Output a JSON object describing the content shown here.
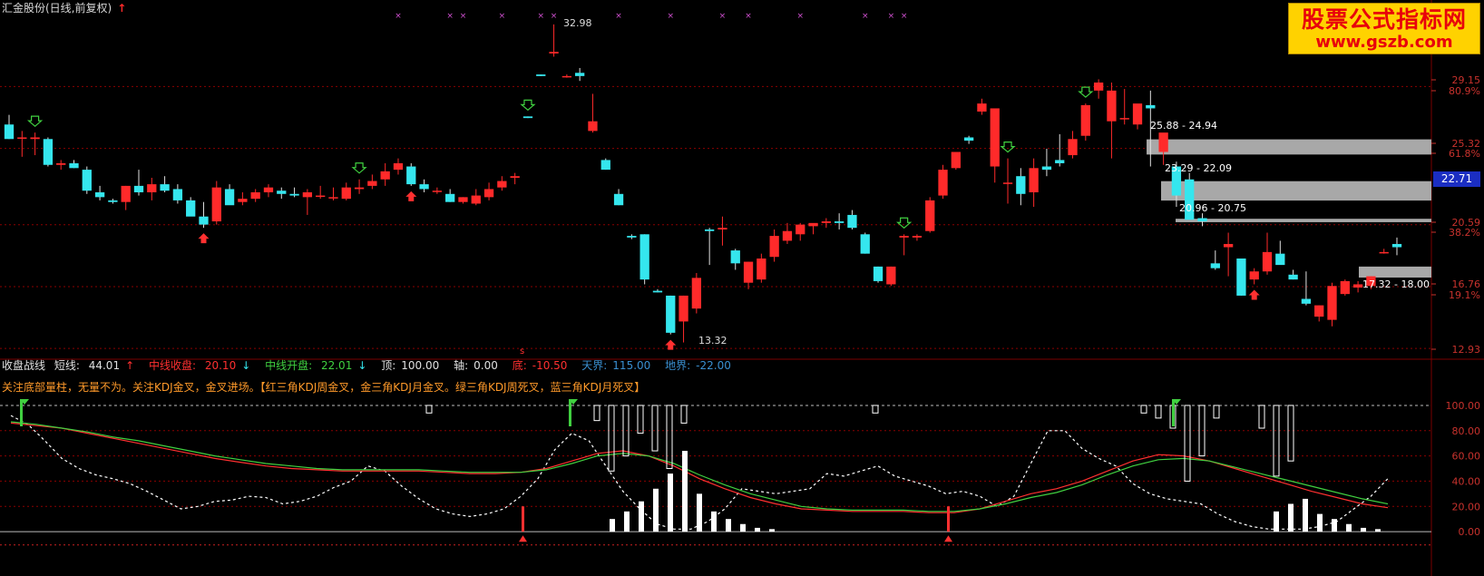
{
  "window": {
    "title": "汇金股份(日线,前复权)",
    "title_arrow": "↑"
  },
  "watermark": {
    "title": "股票公式指标网",
    "url": "www.gszb.com"
  },
  "colors": {
    "up": "#ff2a2a",
    "down": "#35e6ee",
    "bg": "#000000",
    "grid": "#8b0000",
    "zone": "#a8a8a8",
    "ma_red": "#ff3030",
    "ma_green": "#40d040",
    "magenta_marker": "#d050d0",
    "axis_text": "#c8322d"
  },
  "price_axis": {
    "ticks": [
      "29.15",
      "80.9%",
      "25.32",
      "61.8%",
      "20.59",
      "38.2%",
      "16.76",
      "19.1%",
      "12.93"
    ],
    "current_price": "22.71"
  },
  "price_annotations": {
    "high_label": "32.98",
    "low_label": "13.32",
    "zones": [
      "25.88 - 24.94",
      "23.29 - 22.09",
      "20.96 - 20.75",
      "17.32 - 18.00"
    ],
    "marker_s": "s"
  },
  "chart_data": {
    "type": "candlestick",
    "series_ohlc": [
      [
        26.8,
        27.4,
        25.9,
        25.9
      ],
      [
        26.0,
        26.4,
        24.8,
        26.0
      ],
      [
        25.9,
        26.3,
        24.9,
        26.0
      ],
      [
        25.9,
        26.0,
        24.2,
        24.3
      ],
      [
        24.3,
        24.6,
        24.0,
        24.4
      ],
      [
        24.4,
        24.6,
        24.1,
        24.1
      ],
      [
        24.0,
        24.2,
        22.5,
        22.7
      ],
      [
        22.6,
        23.0,
        22.1,
        22.3
      ],
      [
        22.1,
        22.2,
        21.9,
        22.0
      ],
      [
        22.0,
        23.0,
        21.5,
        23.0
      ],
      [
        23.0,
        24.0,
        22.4,
        22.6
      ],
      [
        22.6,
        23.5,
        22.1,
        23.1
      ],
      [
        23.1,
        23.6,
        22.6,
        22.7
      ],
      [
        22.8,
        23.1,
        21.9,
        22.1
      ],
      [
        22.1,
        22.3,
        21.2,
        21.1
      ],
      [
        21.1,
        22.0,
        20.4,
        20.6
      ],
      [
        20.8,
        23.3,
        20.6,
        22.9
      ],
      [
        22.8,
        23.1,
        22.6,
        21.8
      ],
      [
        22.0,
        22.6,
        21.8,
        22.2
      ],
      [
        22.2,
        22.8,
        22.0,
        22.6
      ],
      [
        22.6,
        23.1,
        22.3,
        22.9
      ],
      [
        22.7,
        22.9,
        22.2,
        22.5
      ],
      [
        22.5,
        22.9,
        22.3,
        22.4
      ],
      [
        22.3,
        22.8,
        21.2,
        22.6
      ],
      [
        22.4,
        23.0,
        22.2,
        22.4
      ],
      [
        22.3,
        22.9,
        22.1,
        22.3
      ],
      [
        22.2,
        23.2,
        22.1,
        22.9
      ],
      [
        22.8,
        23.4,
        22.5,
        22.9
      ],
      [
        23.0,
        23.7,
        22.8,
        23.3
      ],
      [
        23.4,
        24.4,
        23.0,
        23.9
      ],
      [
        24.0,
        24.7,
        23.7,
        24.4
      ],
      [
        24.2,
        24.4,
        23.0,
        23.1
      ],
      [
        23.1,
        23.4,
        22.6,
        22.8
      ],
      [
        22.7,
        22.9,
        22.5,
        22.7
      ],
      [
        22.5,
        22.8,
        22.0,
        22.0
      ],
      [
        22.0,
        22.3,
        21.9,
        22.3
      ],
      [
        21.9,
        22.8,
        21.8,
        22.4
      ],
      [
        22.3,
        23.2,
        22.1,
        22.8
      ],
      [
        22.9,
        23.6,
        22.7,
        23.3
      ],
      [
        23.5,
        23.8,
        23.1,
        23.6
      ],
      [
        27.3,
        27.3,
        27.2,
        27.2
      ],
      [
        29.9,
        29.9,
        29.8,
        29.8
      ],
      [
        31.2,
        33.0,
        31.0,
        31.3
      ],
      [
        29.8,
        29.9,
        29.7,
        29.8
      ],
      [
        30.0,
        30.3,
        29.5,
        29.8
      ],
      [
        26.4,
        28.7,
        26.3,
        27.0
      ],
      [
        24.6,
        24.7,
        24.0,
        24.0
      ],
      [
        22.5,
        22.8,
        21.8,
        21.8
      ],
      [
        19.9,
        20.0,
        19.7,
        19.8
      ],
      [
        20.0,
        20.0,
        16.9,
        17.2
      ],
      [
        16.5,
        16.6,
        16.4,
        16.4
      ],
      [
        16.2,
        16.2,
        13.8,
        13.9
      ],
      [
        14.6,
        16.2,
        13.3,
        16.2
      ],
      [
        15.4,
        17.6,
        15.1,
        17.3
      ],
      [
        20.3,
        20.4,
        18.1,
        20.2
      ],
      [
        20.3,
        21.1,
        19.3,
        20.4
      ],
      [
        19.0,
        19.1,
        17.8,
        18.2
      ],
      [
        17.0,
        18.3,
        16.6,
        18.3
      ],
      [
        17.2,
        18.8,
        17.0,
        18.5
      ],
      [
        18.6,
        20.3,
        18.3,
        19.9
      ],
      [
        19.6,
        20.7,
        19.4,
        20.2
      ],
      [
        20.0,
        20.7,
        19.6,
        20.6
      ],
      [
        20.5,
        20.6,
        20.0,
        20.7
      ],
      [
        20.7,
        21.0,
        20.4,
        20.8
      ],
      [
        20.8,
        21.3,
        20.3,
        20.7
      ],
      [
        21.2,
        21.5,
        20.3,
        20.4
      ],
      [
        20.0,
        20.1,
        18.8,
        18.8
      ],
      [
        18.0,
        18.0,
        17.0,
        17.1
      ],
      [
        16.9,
        18.0,
        16.8,
        18.0
      ],
      [
        19.8,
        20.0,
        18.7,
        19.9
      ],
      [
        19.8,
        20.0,
        19.6,
        19.9
      ],
      [
        20.2,
        22.3,
        20.1,
        22.1
      ],
      [
        22.4,
        24.3,
        22.2,
        24.0
      ],
      [
        24.1,
        25.0,
        24.0,
        25.1
      ],
      [
        26.0,
        26.1,
        25.6,
        25.8
      ],
      [
        27.6,
        28.4,
        27.4,
        28.1
      ],
      [
        24.2,
        27.5,
        23.2,
        27.8
      ],
      [
        23.2,
        24.7,
        21.9,
        23.2
      ],
      [
        23.6,
        24.1,
        21.8,
        22.5
      ],
      [
        22.6,
        24.7,
        21.7,
        24.1
      ],
      [
        24.2,
        25.3,
        23.6,
        24.0
      ],
      [
        24.6,
        26.2,
        24.2,
        24.4
      ],
      [
        24.9,
        26.4,
        24.7,
        25.9
      ],
      [
        26.1,
        28.1,
        25.8,
        28.0
      ],
      [
        28.9,
        29.6,
        28.4,
        29.4
      ],
      [
        27.0,
        29.4,
        24.7,
        28.9
      ],
      [
        27.2,
        29.0,
        26.8,
        27.2
      ],
      [
        26.8,
        28.0,
        26.5,
        28.1
      ],
      [
        28.0,
        28.9,
        24.2,
        27.8
      ],
      [
        25.1,
        26.2,
        24.3,
        26.3
      ],
      [
        24.2,
        24.5,
        21.7,
        22.4
      ],
      [
        23.4,
        23.8,
        22.2,
        20.9
      ],
      [
        21.0,
        21.3,
        20.5,
        20.8
      ],
      [
        18.2,
        19.0,
        17.8,
        17.9
      ],
      [
        19.2,
        20.1,
        17.4,
        19.4
      ],
      [
        18.5,
        18.5,
        16.2,
        16.2
      ],
      [
        17.2,
        17.9,
        16.9,
        17.7
      ],
      [
        17.7,
        20.1,
        17.5,
        18.9
      ],
      [
        18.8,
        19.6,
        18.6,
        18.1
      ],
      [
        17.5,
        17.8,
        17.2,
        17.2
      ],
      [
        16.0,
        17.7,
        15.6,
        15.7
      ],
      [
        14.9,
        15.6,
        14.6,
        15.6
      ],
      [
        14.7,
        17.0,
        14.3,
        16.8
      ],
      [
        16.3,
        17.2,
        16.2,
        17.1
      ],
      [
        16.7,
        17.1,
        16.4,
        16.9
      ],
      [
        16.8,
        17.4,
        16.6,
        17.4
      ],
      [
        18.9,
        19.1,
        18.8,
        18.9
      ],
      [
        19.4,
        19.8,
        18.7,
        19.2
      ]
    ],
    "price_range": [
      12.6,
      33.5
    ],
    "indicator": {
      "ylim": [
        -10,
        105
      ],
      "ticks": [
        "100.00",
        "80.00",
        "60.00",
        "40.00",
        "20.00",
        "0.00"
      ],
      "dashed_white": [
        92,
        85,
        72,
        58,
        50,
        45,
        42,
        38,
        32,
        25,
        18,
        20,
        24,
        25,
        28,
        27,
        22,
        24,
        28,
        35,
        40,
        52,
        48,
        36,
        26,
        18,
        14,
        12,
        14,
        18,
        28,
        42,
        65,
        78,
        72,
        52,
        32,
        18,
        6,
        2,
        2,
        8,
        18,
        34,
        32,
        30,
        32,
        34,
        46,
        44,
        48,
        52,
        44,
        40,
        36,
        30,
        32,
        28,
        20,
        28,
        54,
        80,
        80,
        66,
        58,
        52,
        38,
        30,
        26,
        24,
        22,
        14,
        8,
        4,
        2,
        2,
        2,
        4,
        8,
        18,
        28,
        42
      ],
      "ma_red": [
        86,
        84,
        82,
        78,
        74,
        70,
        66,
        62,
        58,
        55,
        52,
        50,
        49,
        48,
        48,
        48,
        48,
        47,
        46,
        46,
        47,
        50,
        56,
        62,
        64,
        60,
        52,
        42,
        34,
        27,
        22,
        18,
        17,
        16,
        16,
        16,
        15,
        15,
        18,
        24,
        30,
        34,
        40,
        48,
        56,
        61,
        60,
        56,
        50,
        44,
        38,
        32,
        27,
        22,
        19
      ],
      "ma_green": [
        87,
        85,
        82,
        79,
        75,
        72,
        68,
        64,
        60,
        57,
        54,
        52,
        50,
        49,
        49,
        49,
        49,
        48,
        47,
        47,
        47,
        49,
        54,
        60,
        62,
        60,
        54,
        45,
        37,
        30,
        25,
        20,
        18,
        17,
        17,
        17,
        16,
        16,
        18,
        22,
        27,
        31,
        37,
        45,
        52,
        57,
        58,
        56,
        51,
        46,
        41,
        36,
        31,
        26,
        22
      ]
    }
  },
  "indicator_header": {
    "name": "收盘战线",
    "short_label": "短线:",
    "short_value": "44.01",
    "short_arrow": "↑",
    "mid_close_label": "中线收盘:",
    "mid_close_value": "20.10",
    "mid_close_arrow": "↓",
    "mid_open_label": "中线开盘:",
    "mid_open_value": "22.01",
    "mid_open_arrow": "↓",
    "top_label": "顶:",
    "top_value": "100.00",
    "axis_label": "轴:",
    "axis_value": "0.00",
    "bottom_label": "底:",
    "bottom_value": "-10.50",
    "sky_label": "天界:",
    "sky_value": "115.00",
    "earth_label": "地界:",
    "earth_value": "-22.00"
  },
  "indicator_note": "关注底部量柱，无量不为。关注KDJ金叉，金叉进场。【红三角KDJ周金叉，金三角KDJ月金叉。绿三角KDJ周死叉，蓝三角KDJ月死叉】"
}
